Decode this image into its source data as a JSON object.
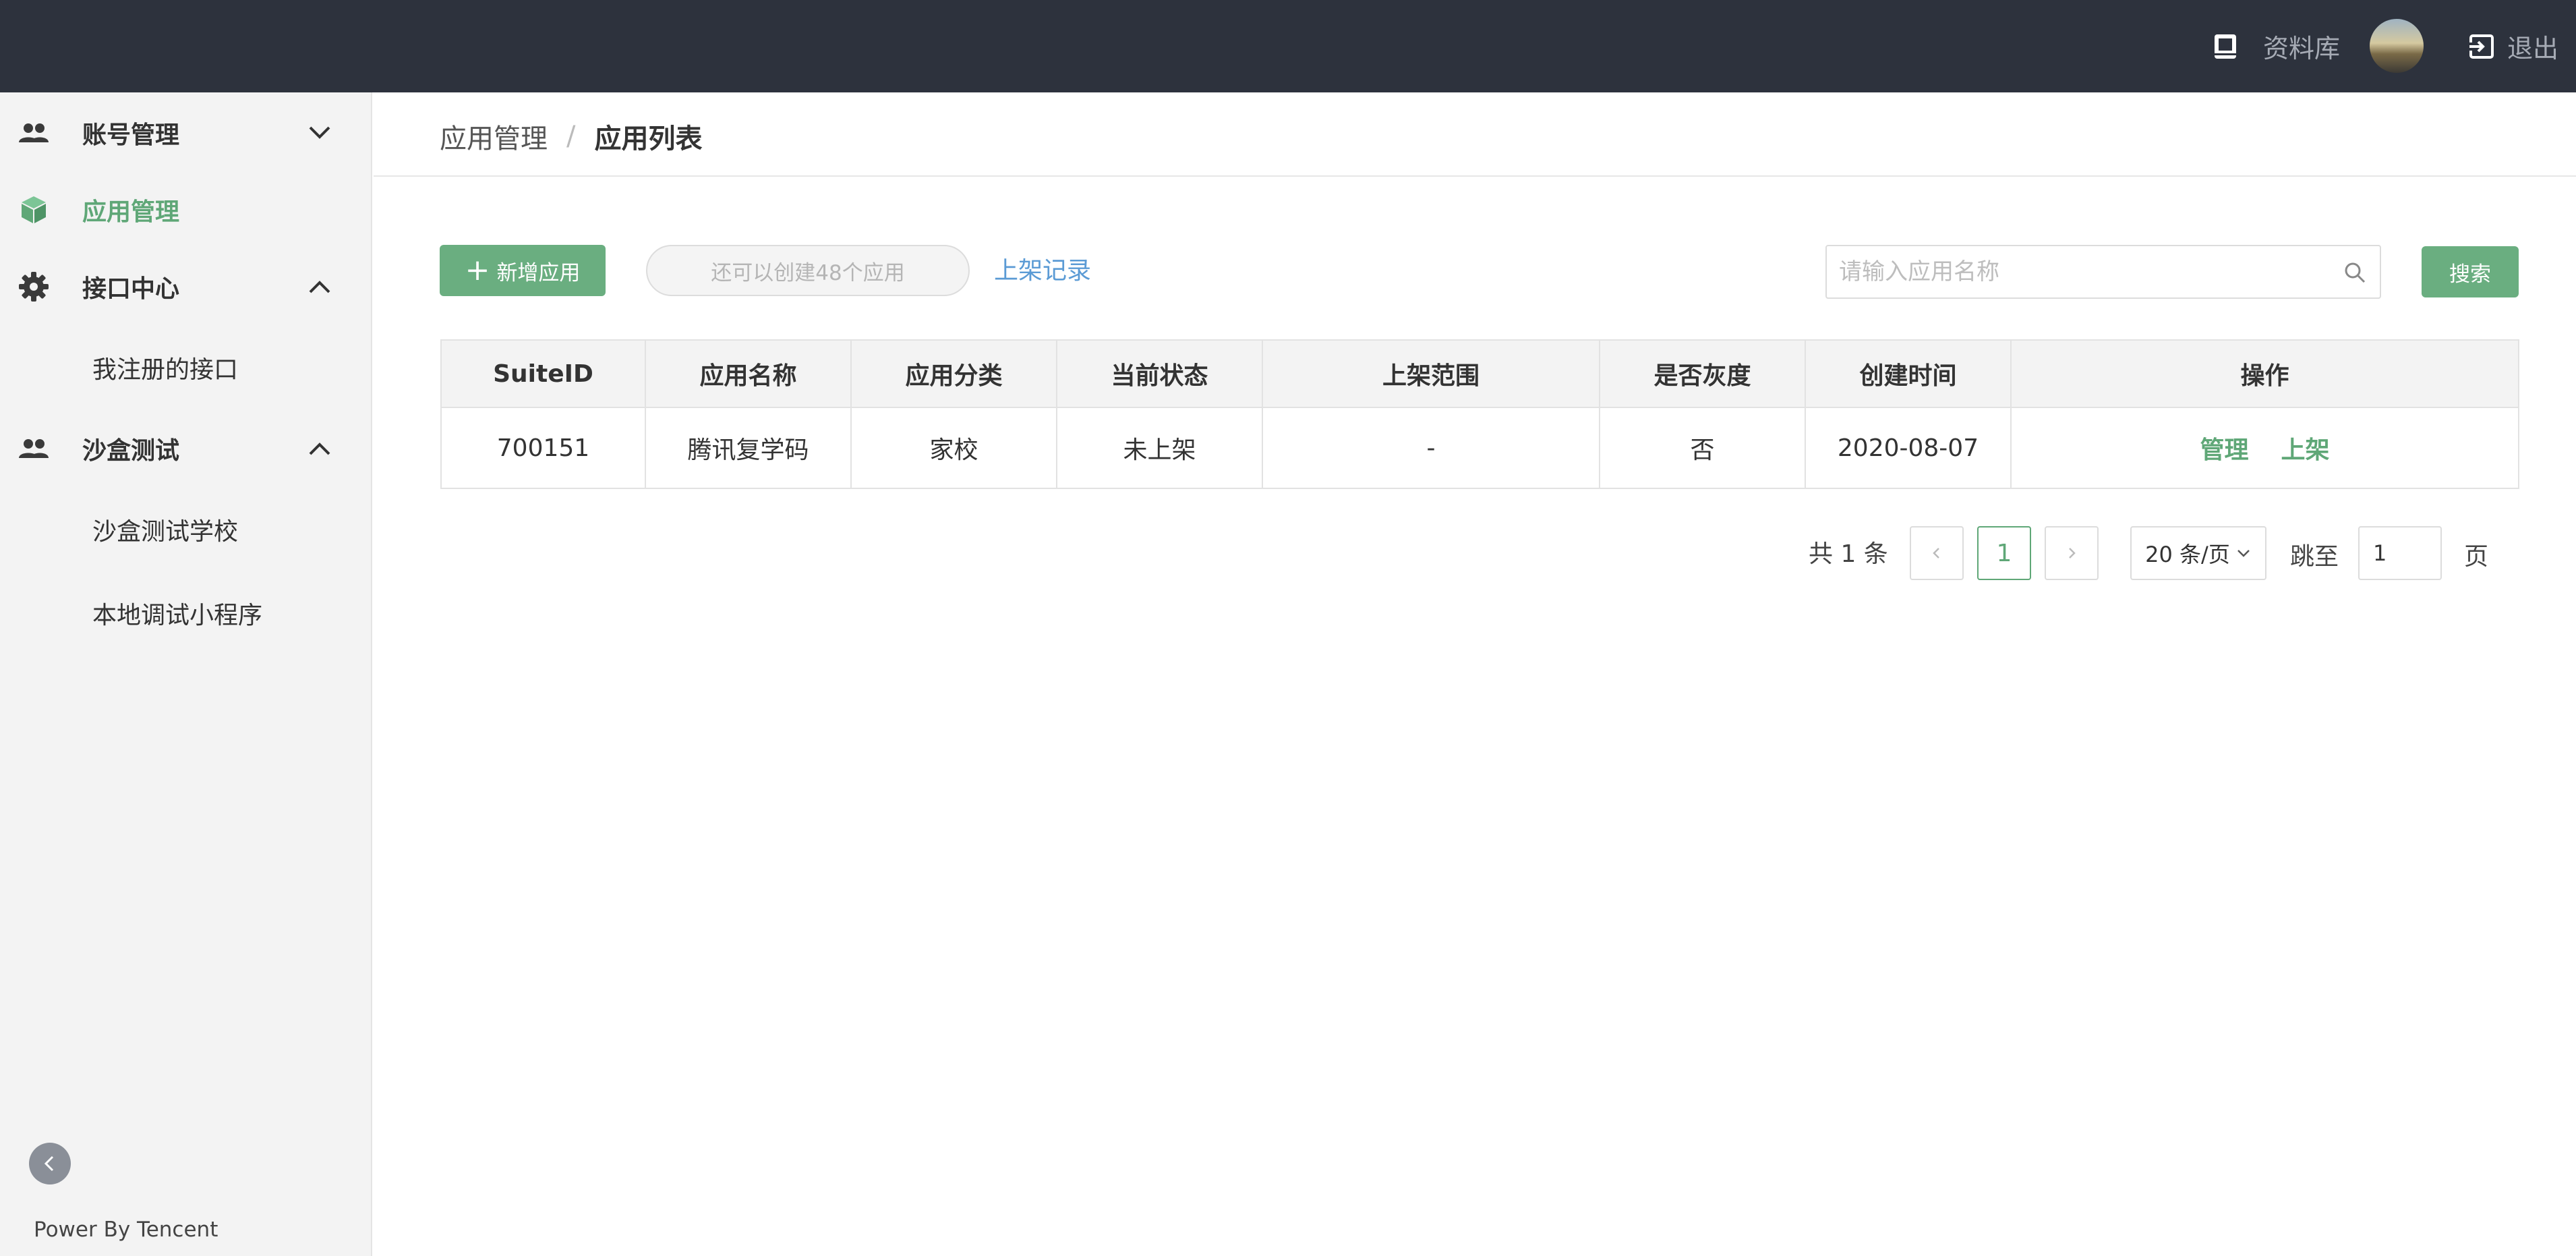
{
  "topbar": {
    "library_label": "资料库",
    "logout_label": "退出"
  },
  "sidebar": {
    "items": [
      {
        "label": "账号管理",
        "icon": "people-icon",
        "expanded": false
      },
      {
        "label": "应用管理",
        "icon": "cube-icon",
        "active": true
      },
      {
        "label": "接口中心",
        "icon": "gear-icon",
        "expanded": true,
        "children": [
          {
            "label": "我注册的接口"
          }
        ]
      },
      {
        "label": "沙盒测试",
        "icon": "people-icon",
        "expanded": true,
        "children": [
          {
            "label": "沙盒测试学校"
          },
          {
            "label": "本地调试小程序"
          }
        ]
      }
    ],
    "footer": "Power By Tencent"
  },
  "breadcrumb": {
    "parent": "应用管理",
    "separator": "/",
    "current": "应用列表"
  },
  "toolbar": {
    "add_label": "新增应用",
    "quota_label": "还可以创建48个应用",
    "record_link": "上架记录",
    "search_placeholder": "请输入应用名称",
    "search_label": "搜索"
  },
  "table": {
    "columns": [
      "SuiteID",
      "应用名称",
      "应用分类",
      "当前状态",
      "上架范围",
      "是否灰度",
      "创建时间",
      "操作"
    ],
    "rows": [
      {
        "suite_id": "700151",
        "name": "腾讯复学码",
        "category": "家校",
        "status": "未上架",
        "scope": "-",
        "gray": "否",
        "created": "2020-08-07",
        "actions": [
          "管理",
          "上架"
        ]
      }
    ]
  },
  "pagination": {
    "total_label": "共 1 条",
    "current_page": "1",
    "page_size_label": "20 条/页",
    "goto_label": "跳至",
    "goto_value": "1",
    "goto_suffix": "页"
  },
  "colors": {
    "accent": "#6aae80",
    "topbar": "#2d323d",
    "link": "#5b9bd5"
  }
}
